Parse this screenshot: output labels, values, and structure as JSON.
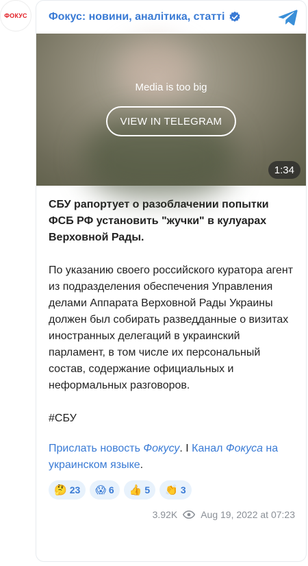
{
  "avatar": {
    "label": "ФОКУС"
  },
  "header": {
    "title": "Фокус: новини, аналітика, статті"
  },
  "media": {
    "message": "Media is too big",
    "button_label": "VIEW IN TELEGRAM",
    "duration": "1:34"
  },
  "post": {
    "headline": "СБУ рапортует о разоблачении попытки ФСБ РФ установить \"жучки\" в кулуарах Верховной Рады.",
    "paragraph": "По указанию своего российского куратора агент из подразделения обеспечения Управления делами Аппарата Верховной Рады Украины должен был собирать разведданные о визитах иностранных делегаций в украинский парламент, в том числе их персональный состав, содержание официальных и неформальных разговоров.",
    "hashtag": "#СБУ",
    "links": {
      "send_news": "Прислать новость ",
      "fokusu": "Фокусу",
      "sep": ". I ",
      "channel": "Канал ",
      "fokusa": "Фокуса",
      "ukrainian": " на украинском языке",
      "end": "."
    }
  },
  "reactions": [
    {
      "emoji": "🤔",
      "count": "23"
    },
    {
      "emoji": "😱",
      "count": "6"
    },
    {
      "emoji": "👍",
      "count": "5"
    },
    {
      "emoji": "👏",
      "count": "3"
    }
  ],
  "footer": {
    "views": "3.92K",
    "date": "Aug 19, 2022 at 07:23"
  },
  "colors": {
    "accent": "#3a7bd5",
    "brand": "#e11b22"
  }
}
